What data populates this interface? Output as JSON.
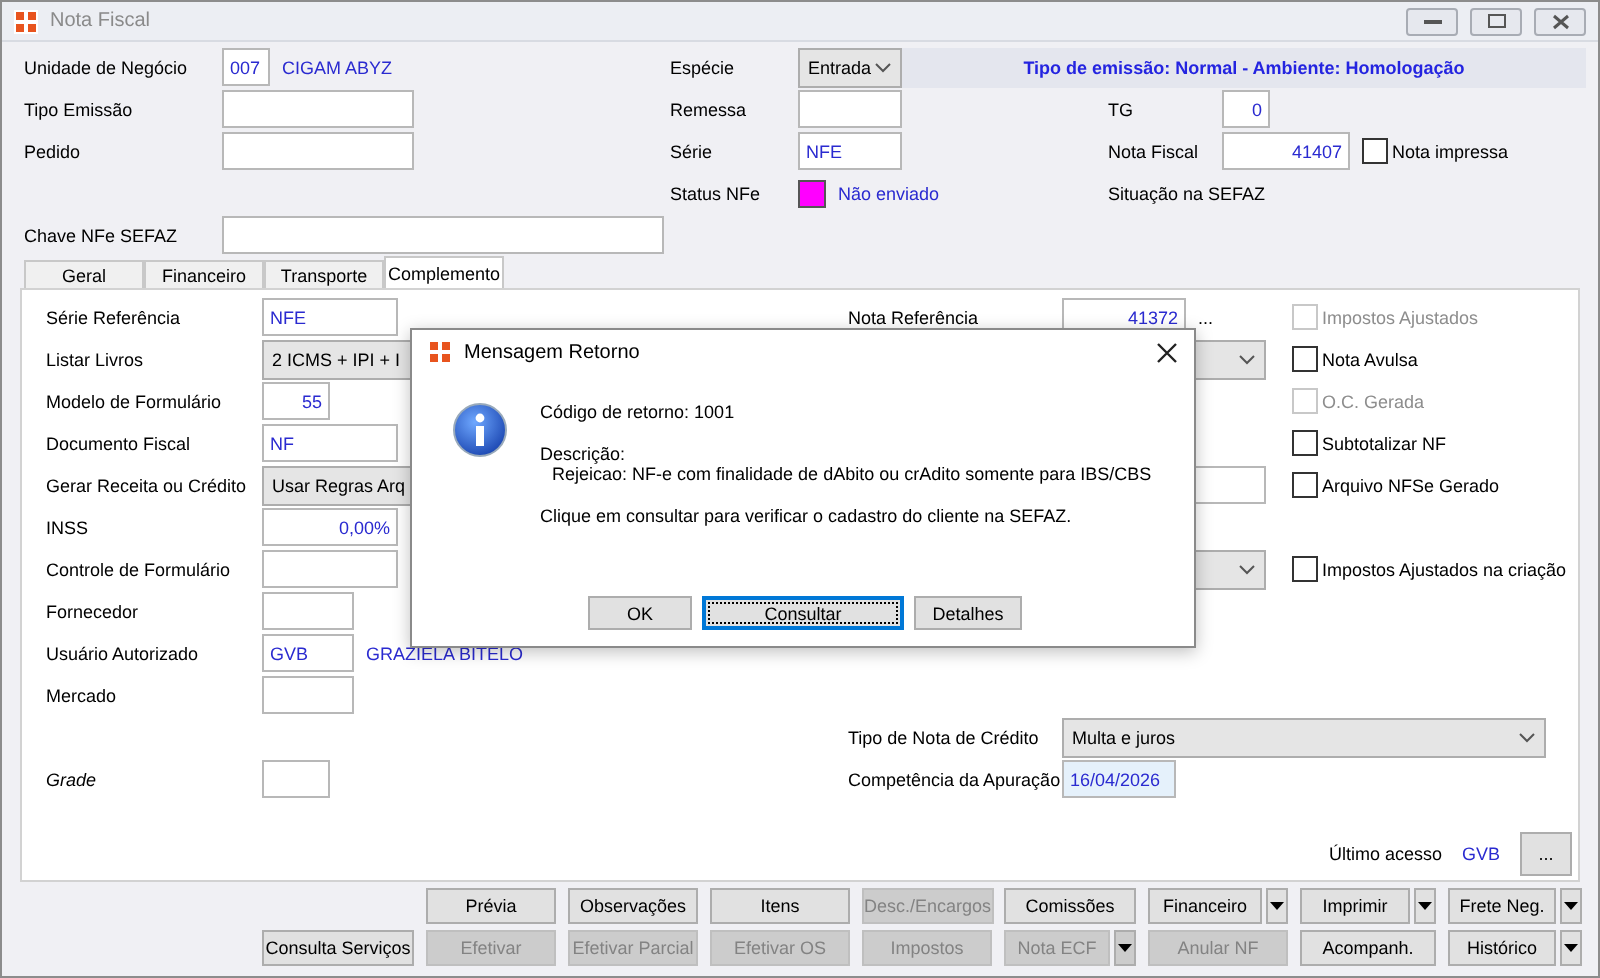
{
  "window": {
    "title": "Nota Fiscal"
  },
  "header": {
    "unidade": {
      "label": "Unidade de Negócio",
      "code": "007",
      "name": "CIGAM ABYZ"
    },
    "tipo_emissao": {
      "label": "Tipo Emissão"
    },
    "pedido": {
      "label": "Pedido"
    },
    "chave": {
      "label": "Chave NFe SEFAZ"
    },
    "especie": {
      "label": "Espécie",
      "value": "Entrada"
    },
    "remessa": {
      "label": "Remessa"
    },
    "serie": {
      "label": "Série",
      "value": "NFE"
    },
    "status": {
      "label": "Status NFe",
      "color": "#ff00ff",
      "text": "Não enviado"
    },
    "banner": "Tipo de emissão: Normal - Ambiente: Homologação",
    "tg": {
      "label": "TG",
      "value": "0"
    },
    "nota_fiscal": {
      "label": "Nota Fiscal",
      "value": "41407"
    },
    "nota_impressa": {
      "label": "Nota impressa",
      "checked": false
    },
    "situacao": {
      "label": "Situação na SEFAZ"
    }
  },
  "tabs": [
    {
      "label": "Geral",
      "selected": false
    },
    {
      "label": "Financeiro",
      "selected": false
    },
    {
      "label": "Transporte",
      "selected": false
    },
    {
      "label": "Complemento",
      "selected": true
    }
  ],
  "panel": {
    "left": [
      {
        "label": "Série Referência",
        "kind": "field",
        "value": "NFE"
      },
      {
        "label": "Listar Livros",
        "kind": "select",
        "value": "2 ICMS + IPI + I"
      },
      {
        "label": "Modelo de Formulário",
        "kind": "number",
        "value": "55"
      },
      {
        "label": "Documento Fiscal",
        "kind": "field",
        "value": "NF"
      },
      {
        "label": "Gerar Receita ou Crédito",
        "kind": "select",
        "value": "Usar Regras Arq"
      },
      {
        "label": "INSS",
        "kind": "number",
        "value": "0,00%"
      },
      {
        "label": "Controle de Formulário",
        "kind": "field"
      },
      {
        "label": "Fornecedor",
        "kind": "field"
      },
      {
        "label": "Usuário Autorizado",
        "kind": "field",
        "value": "GVB",
        "name": "GRAZIELA BITELO"
      },
      {
        "label": "Mercado",
        "kind": "field"
      }
    ],
    "grade": {
      "label": "Grade"
    },
    "nota_referencia": {
      "label": "Nota Referência",
      "value": "41372",
      "more": "..."
    },
    "checks": [
      {
        "label": "Impostos Ajustados",
        "checked": false,
        "disabled": true
      },
      {
        "label": "Nota Avulsa",
        "checked": false,
        "disabled": false
      },
      {
        "label": "O.C. Gerada",
        "checked": false,
        "disabled": true
      },
      {
        "label": "Subtotalizar NF",
        "checked": false,
        "disabled": false
      },
      {
        "label": "Arquivo NFSe Gerado",
        "checked": false,
        "disabled": false
      },
      {
        "label": "Impostos Ajustados na criação",
        "checked": false,
        "disabled": false
      }
    ],
    "tipo_nota_credito": {
      "label": "Tipo de Nota de Crédito",
      "value": "Multa e juros"
    },
    "competencia": {
      "label": "Competência da Apuração",
      "value": "16/04/2026"
    },
    "ultimo_acesso": {
      "label": "Último acesso",
      "value": "GVB",
      "more": "..."
    }
  },
  "buttons": [
    [
      {
        "label": "Prévia",
        "disabled": false
      },
      {
        "label": "Observações",
        "disabled": false
      },
      {
        "label": "Itens",
        "disabled": false
      },
      {
        "label": "Desc./Encargos",
        "disabled": true
      },
      {
        "label": "Comissões",
        "disabled": false
      },
      {
        "label": "Financeiro",
        "disabled": false,
        "dropdown": true
      },
      {
        "label": "Imprimir",
        "disabled": false,
        "dropdown": true
      },
      {
        "label": "Frete Neg.",
        "disabled": false,
        "dropdown": true
      }
    ],
    [
      {
        "label": "Consulta Serviços",
        "disabled": false
      },
      {
        "label": "Efetivar",
        "disabled": true
      },
      {
        "label": "Efetivar Parcial",
        "disabled": true
      },
      {
        "label": "Efetivar OS",
        "disabled": true
      },
      {
        "label": "Impostos",
        "disabled": true
      },
      {
        "label": "Nota ECF",
        "disabled": true,
        "dropdown": true
      },
      {
        "label": "Anular NF",
        "disabled": true
      },
      {
        "label": "Acompanh.",
        "disabled": false
      },
      {
        "label": "Histórico",
        "disabled": false,
        "dropdown": true
      }
    ]
  ],
  "dialog": {
    "title": "Mensagem Retorno",
    "lines": [
      "Código de retorno: 1001",
      "Descrição:",
      "Rejeicao: NF-e com finalidade de dAbito ou crAdito somente para IBS/CBS",
      "Clique em consultar para verificar o cadastro do cliente na SEFAZ."
    ],
    "buttons": [
      {
        "label": "OK",
        "focused": false
      },
      {
        "label": "Consultar",
        "focused": true
      },
      {
        "label": "Detalhes",
        "focused": false
      }
    ]
  }
}
